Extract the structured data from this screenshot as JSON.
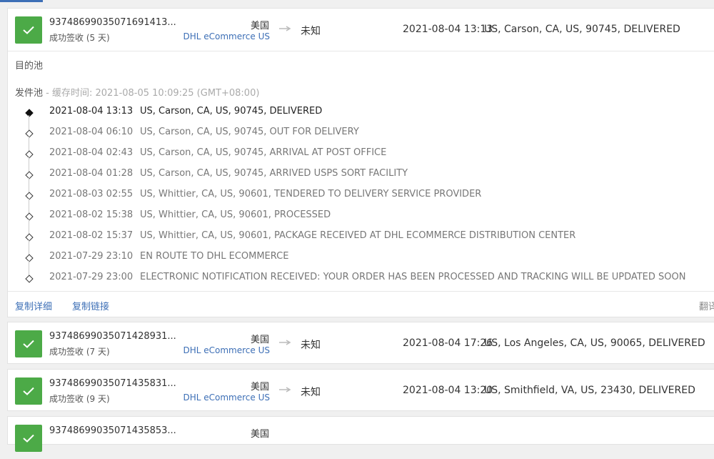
{
  "colors": {
    "accent": "#3d6fb6",
    "success": "#4caa47"
  },
  "icons": {
    "status": "check-icon",
    "route": "arrow-right-icon",
    "event": "diamond-icon"
  },
  "cards": [
    {
      "number": "93748699035071691413...",
      "status": "成功签收 (5 天)",
      "country": "美国",
      "carrier": "DHL eCommerce US",
      "destination": "未知",
      "last_time": "2021-08-04 13:13",
      "last_desc": "US, Carson, CA, US, 90745, DELIVERED"
    },
    {
      "number": "93748699035071428931...",
      "status": "成功签收 (7 天)",
      "country": "美国",
      "carrier": "DHL eCommerce US",
      "destination": "未知",
      "last_time": "2021-08-04 17:26",
      "last_desc": "US, Los Angeles, CA, US, 90065, DELIVERED"
    },
    {
      "number": "93748699035071435831...",
      "status": "成功签收 (9 天)",
      "country": "美国",
      "carrier": "DHL eCommerce US",
      "destination": "未知",
      "last_time": "2021-08-04 13:20",
      "last_desc": "US, Smithfield, VA, US, 23430, DELIVERED"
    },
    {
      "number": "93748699035071435853...",
      "status": "",
      "country": "美国",
      "carrier": "",
      "destination": "",
      "last_time": "",
      "last_desc": ""
    }
  ],
  "detail": {
    "dest_pool": "目的池",
    "origin_pool": "发件池",
    "cache_label": " - 缓存时间: 2021-08-05 10:09:25 (GMT+08:00)",
    "events": [
      {
        "time": "2021-08-04 13:13",
        "desc": "US, Carson, CA, US, 90745, DELIVERED"
      },
      {
        "time": "2021-08-04 06:10",
        "desc": "US, Carson, CA, US, 90745, OUT FOR DELIVERY"
      },
      {
        "time": "2021-08-04 02:43",
        "desc": "US, Carson, CA, US, 90745, ARRIVAL AT POST OFFICE"
      },
      {
        "time": "2021-08-04 01:28",
        "desc": "US, Carson, CA, US, 90745, ARRIVED USPS SORT FACILITY"
      },
      {
        "time": "2021-08-03 02:55",
        "desc": "US, Whittier, CA, US, 90601, TENDERED TO DELIVERY SERVICE PROVIDER"
      },
      {
        "time": "2021-08-02 15:38",
        "desc": "US, Whittier, CA, US, 90601, PROCESSED"
      },
      {
        "time": "2021-08-02 15:37",
        "desc": "US, Whittier, CA, US, 90601, PACKAGE RECEIVED AT DHL ECOMMERCE DISTRIBUTION CENTER"
      },
      {
        "time": "2021-07-29 23:10",
        "desc": "EN ROUTE TO DHL ECOMMERCE"
      },
      {
        "time": "2021-07-29 23:00",
        "desc": "ELECTRONIC NOTIFICATION RECEIVED: YOUR ORDER HAS BEEN PROCESSED AND TRACKING WILL BE UPDATED SOON"
      }
    ],
    "copy_detail": "复制详细",
    "copy_link": "复制链接",
    "translate": "翻译"
  }
}
